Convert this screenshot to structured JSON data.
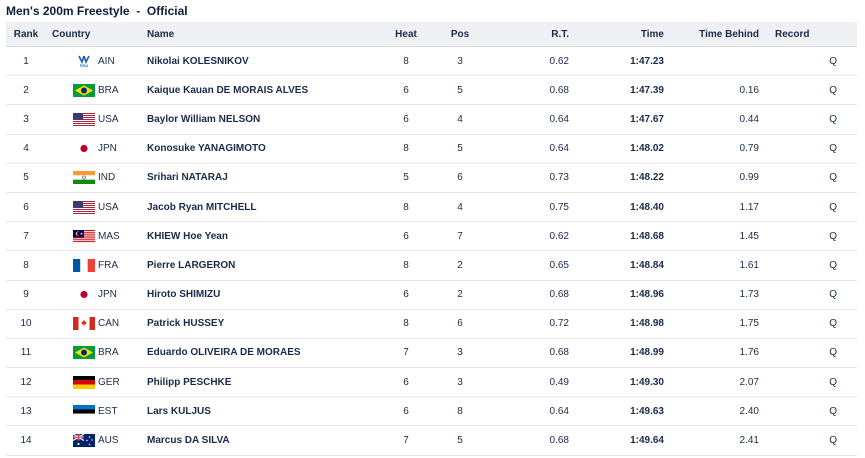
{
  "title": "Men's 200m Freestyle  -  Official",
  "headers": {
    "rank": "Rank",
    "country": "Country",
    "name": "Name",
    "heat": "Heat",
    "pos": "Pos",
    "rt": "R.T.",
    "time": "Time",
    "behind": "Time Behind",
    "record": "Record"
  },
  "rows": [
    {
      "rank": "1",
      "country": "AIN",
      "flag": "fisu-icon",
      "name": "Nikolai KOLESNIKOV",
      "heat": "8",
      "pos": "3",
      "rt": "0.62",
      "time": "1:47.23",
      "behind": "",
      "record": "Q"
    },
    {
      "rank": "2",
      "country": "BRA",
      "flag": "flag-bra-icon",
      "name": "Kaique Kauan DE MORAIS ALVES",
      "heat": "6",
      "pos": "5",
      "rt": "0.68",
      "time": "1:47.39",
      "behind": "0.16",
      "record": "Q"
    },
    {
      "rank": "3",
      "country": "USA",
      "flag": "flag-usa-icon",
      "name": "Baylor William NELSON",
      "heat": "6",
      "pos": "4",
      "rt": "0.64",
      "time": "1:47.67",
      "behind": "0.44",
      "record": "Q"
    },
    {
      "rank": "4",
      "country": "JPN",
      "flag": "flag-jpn-icon",
      "name": "Konosuke YANAGIMOTO",
      "heat": "8",
      "pos": "5",
      "rt": "0.64",
      "time": "1:48.02",
      "behind": "0.79",
      "record": "Q"
    },
    {
      "rank": "5",
      "country": "IND",
      "flag": "flag-ind-icon",
      "name": "Srihari NATARAJ",
      "heat": "5",
      "pos": "6",
      "rt": "0.73",
      "time": "1:48.22",
      "behind": "0.99",
      "record": "Q"
    },
    {
      "rank": "6",
      "country": "USA",
      "flag": "flag-usa-icon",
      "name": "Jacob Ryan MITCHELL",
      "heat": "8",
      "pos": "4",
      "rt": "0.75",
      "time": "1:48.40",
      "behind": "1.17",
      "record": "Q"
    },
    {
      "rank": "7",
      "country": "MAS",
      "flag": "flag-mas-icon",
      "name": "KHIEW Hoe Yean",
      "heat": "6",
      "pos": "7",
      "rt": "0.62",
      "time": "1:48.68",
      "behind": "1.45",
      "record": "Q"
    },
    {
      "rank": "8",
      "country": "FRA",
      "flag": "flag-fra-icon",
      "name": "Pierre LARGERON",
      "heat": "8",
      "pos": "2",
      "rt": "0.65",
      "time": "1:48.84",
      "behind": "1.61",
      "record": "Q"
    },
    {
      "rank": "9",
      "country": "JPN",
      "flag": "flag-jpn-icon",
      "name": "Hiroto SHIMIZU",
      "heat": "6",
      "pos": "2",
      "rt": "0.68",
      "time": "1:48.96",
      "behind": "1.73",
      "record": "Q"
    },
    {
      "rank": "10",
      "country": "CAN",
      "flag": "flag-can-icon",
      "name": "Patrick HUSSEY",
      "heat": "8",
      "pos": "6",
      "rt": "0.72",
      "time": "1:48.98",
      "behind": "1.75",
      "record": "Q"
    },
    {
      "rank": "11",
      "country": "BRA",
      "flag": "flag-bra-icon",
      "name": "Eduardo OLIVEIRA DE MORAES",
      "heat": "7",
      "pos": "3",
      "rt": "0.68",
      "time": "1:48.99",
      "behind": "1.76",
      "record": "Q"
    },
    {
      "rank": "12",
      "country": "GER",
      "flag": "flag-ger-icon",
      "name": "Philipp PESCHKE",
      "heat": "6",
      "pos": "3",
      "rt": "0.49",
      "time": "1:49.30",
      "behind": "2.07",
      "record": "Q"
    },
    {
      "rank": "13",
      "country": "EST",
      "flag": "flag-est-icon",
      "name": "Lars KULJUS",
      "heat": "6",
      "pos": "8",
      "rt": "0.64",
      "time": "1:49.63",
      "behind": "2.40",
      "record": "Q"
    },
    {
      "rank": "14",
      "country": "AUS",
      "flag": "flag-aus-icon",
      "name": "Marcus DA SILVA",
      "heat": "7",
      "pos": "5",
      "rt": "0.68",
      "time": "1:49.64",
      "behind": "2.41",
      "record": "Q"
    }
  ]
}
